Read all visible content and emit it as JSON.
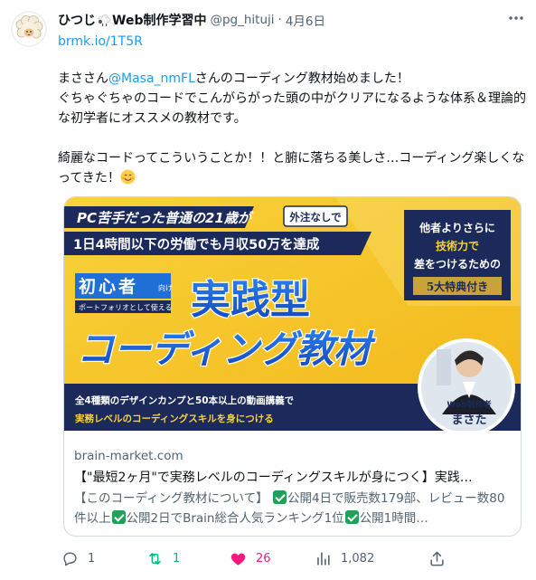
{
  "tweet": {
    "display_name": "ひつじ",
    "display_name_suffix": "Web制作学習中",
    "handle": "@pg_hituji",
    "separator": "·",
    "date": "4月6日",
    "link": "brmk.io/1T5R",
    "text_before_mention": "まささん",
    "mention": "@Masa_nmFL",
    "text_after_mention": "さんのコーディング教材始めました！\nぐちゃぐちゃのコードでこんがらがった頭の中がクリアになるような体系＆理論的な初学者にオススメの教材です。\n\n綺麗なコードってこういうことか！！と腑に落ちる美しさ…コーディング楽しくなってきた！"
  },
  "card": {
    "image": {
      "banner_top": "PC苦手だった普通の21歳が",
      "badge": "外注なしで",
      "banner_line2": "1日4時間以下の労働でも月収50万を達成",
      "box_line1": "他者よりさらに",
      "box_line2": "技術力で",
      "box_line3": "差をつけるための",
      "box_ribbon": "5大特典付き",
      "beginner_label": "初心者",
      "beginner_small": "向け",
      "portfolio_label": "ポートフォリオとして使える",
      "main_title_1": "実践型",
      "main_title_2": "コーディング教材",
      "bottom_line1": "全4種類のデザインカンプと50本以上の動画講義で",
      "bottom_line2": "実務レベルのコーディングスキルを身につける",
      "author_role": "Web制作者",
      "author_name": "まさた"
    },
    "domain": "brain-market.com",
    "title": "【\"最短2ヶ月\"で実務レベルのコーディングスキルが身につく】実践…",
    "desc_1": "【このコーディング教材について】",
    "desc_2": "公開4日で販売数179部、レビュー数80件以上",
    "desc_3": "公開2日でBrain総合人気ランキング1位",
    "desc_4": "公開1時間…"
  },
  "actions": {
    "reply_count": "1",
    "retweet_count": "1",
    "like_count": "26",
    "view_count": "1,082"
  },
  "colors": {
    "accent": "#1d9bf0",
    "retweet": "#00ba7c",
    "like": "#f91880",
    "banner_yellow": "#f6c21c",
    "banner_navy": "#1b2a5a"
  },
  "icons": [
    "sheep-avatar-icon",
    "sheep-emoji-icon",
    "more-icon",
    "smile-emoji-icon",
    "check-emoji-icon",
    "reply-icon",
    "retweet-icon",
    "like-icon",
    "views-icon",
    "share-icon"
  ]
}
